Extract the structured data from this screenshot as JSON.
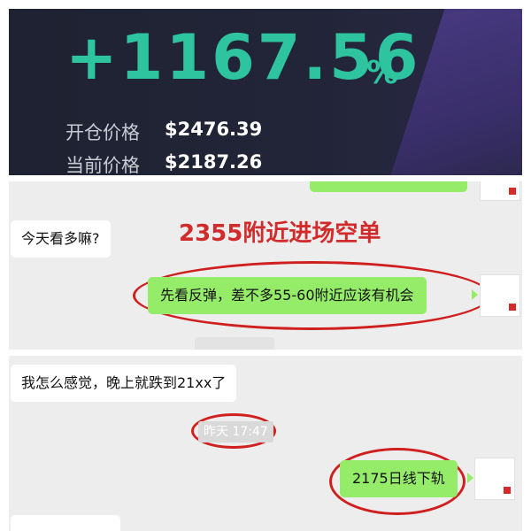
{
  "profit_card": {
    "percent": "+1167.56",
    "percent_sign": "%",
    "open_price_label": "开仓价格",
    "open_price_value": "$2476.39",
    "current_price_label": "当前价格",
    "current_price_value": "$2187.26"
  },
  "chat1": {
    "incoming_message": "今天看多嘛?",
    "annotation": "2355附近进场空单",
    "outgoing_message": "先看反弹，差不多55-60附近应该有机会"
  },
  "chat2": {
    "incoming_message": "我怎么感觉，晚上就跌到21xx了",
    "timestamp": "昨天 17:47",
    "outgoing_message": "2175日线下轨"
  },
  "colors": {
    "profit_green": "#2ec4a0",
    "bubble_green": "#95ec69",
    "annotation_red": "#d22b2b",
    "card_bg": "#1f2231"
  }
}
